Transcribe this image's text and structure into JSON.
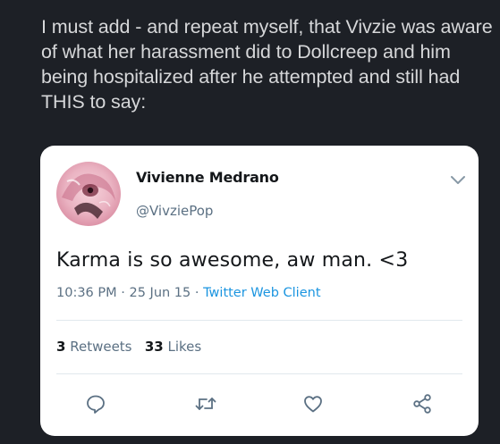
{
  "post": {
    "text": "I must add - and repeat myself, that Vivzie was aware of what her harassment did to Dollcreep and him being hospitalized after he attempted and still had THIS to say:"
  },
  "tweet": {
    "display_name": "Vivienne Medrano",
    "handle": "@VivziePop",
    "body": "Karma is so awesome, aw man. <3",
    "time": "10:36 PM",
    "separator": "·",
    "date": "25 Jun 15",
    "client": "Twitter Web Client",
    "retweets_count": "3",
    "retweets_label": "Retweets",
    "likes_count": "33",
    "likes_label": "Likes"
  },
  "colors": {
    "background": "#1d2026",
    "card": "#ffffff",
    "link": "#1b95e0",
    "secondary_text": "#5b7083",
    "icon": "#5b7083"
  },
  "icons": [
    "chevron-down-icon",
    "reply-icon",
    "retweet-icon",
    "like-icon",
    "share-icon"
  ]
}
